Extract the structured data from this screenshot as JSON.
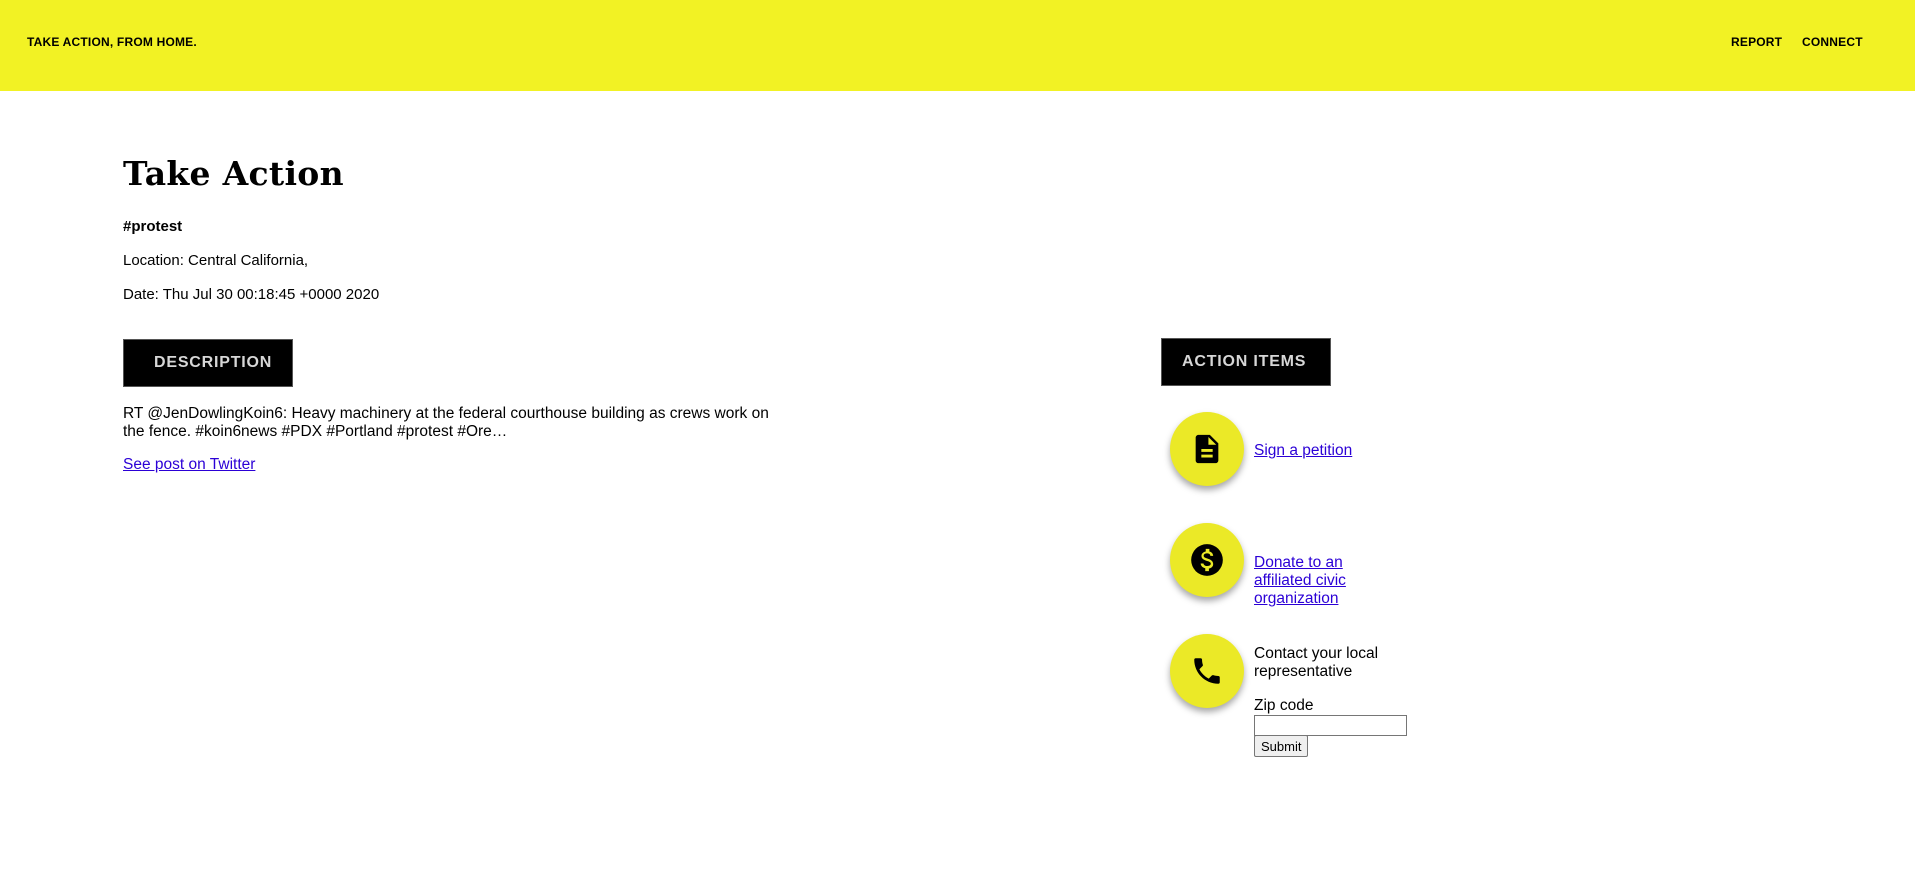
{
  "header": {
    "brand": "TAKE ACTION, FROM HOME.",
    "nav": [
      "REPORT",
      "CONNECT"
    ]
  },
  "main": {
    "title": "Take Action",
    "hashtag": "#protest",
    "location": "Location: Central California,",
    "date": "Date: Thu Jul 30 00:18:45 +0000 2020"
  },
  "description": {
    "label": "DESCRIPTION",
    "text": "RT @JenDowlingKoin6: Heavy machinery at the federal courthouse building as crews work on the fence. #koin6news #PDX #Portland #protest #Ore…",
    "link_label": "See post on Twitter"
  },
  "actions": {
    "label": "ACTION ITEMS",
    "items": [
      {
        "icon": "document-icon",
        "label": "Sign a petition"
      },
      {
        "icon": "dollar-icon",
        "label": "Donate to an affiliated civic organization"
      },
      {
        "icon": "phone-icon",
        "label": "Contact your local representative"
      }
    ],
    "zip_label": "Zip code",
    "zip_value": "",
    "submit_label": "Submit"
  },
  "colors": {
    "header_bg": "#f2f224",
    "circle_bg": "#ebe927",
    "link": "#2b00d6"
  }
}
